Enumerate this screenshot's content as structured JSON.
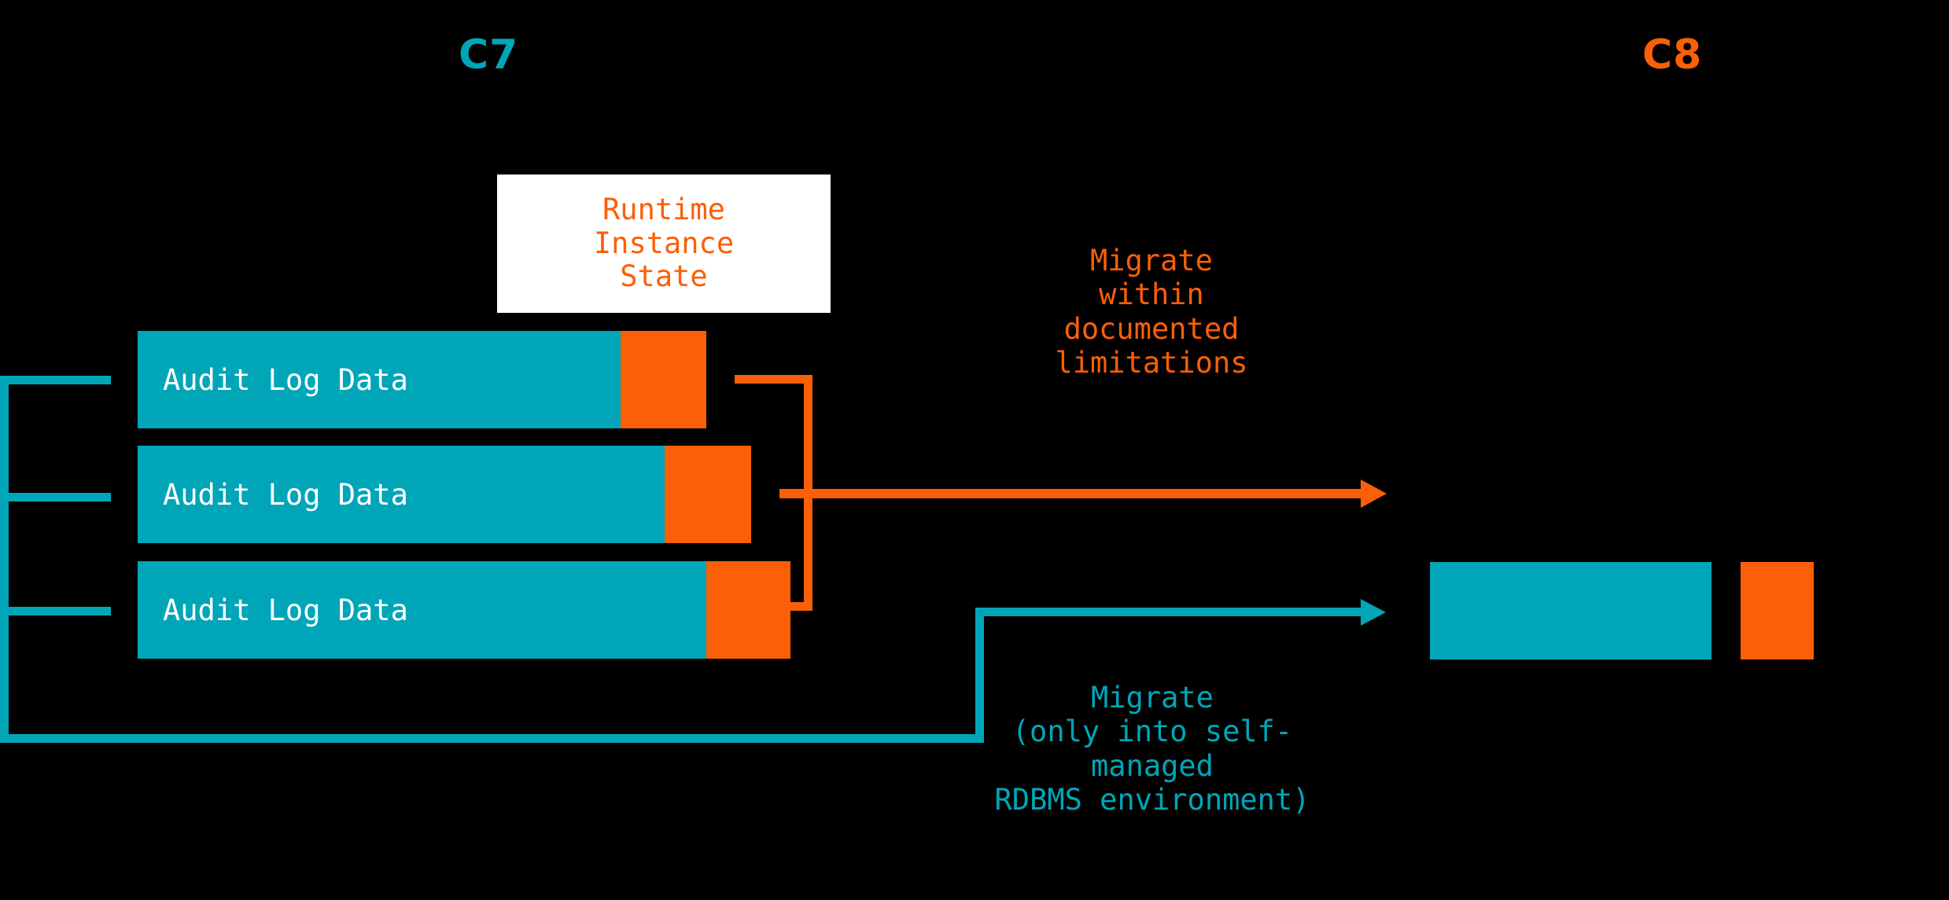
{
  "headings": {
    "left": "C7",
    "right": "C8"
  },
  "colors": {
    "background": "#000000",
    "teal": "#00A6B8",
    "orange": "#FB5F07",
    "card_background": "#FFFFFF",
    "bar_label": "#FFFFFF"
  },
  "runtime_card": {
    "label": "Runtime\nInstance\nState"
  },
  "audit_bars": [
    {
      "label": "Audit Log Data"
    },
    {
      "label": "Audit Log Data"
    },
    {
      "label": "Audit Log Data"
    }
  ],
  "arrows": {
    "orange": {
      "caption": "Migrate\nwithin\ndocumented\nlimitations"
    },
    "teal": {
      "caption": "Migrate\n(only into self-\nmanaged\nRDBMS environment)"
    }
  },
  "target_boxes": {
    "teal_label": "",
    "orange_label": ""
  }
}
